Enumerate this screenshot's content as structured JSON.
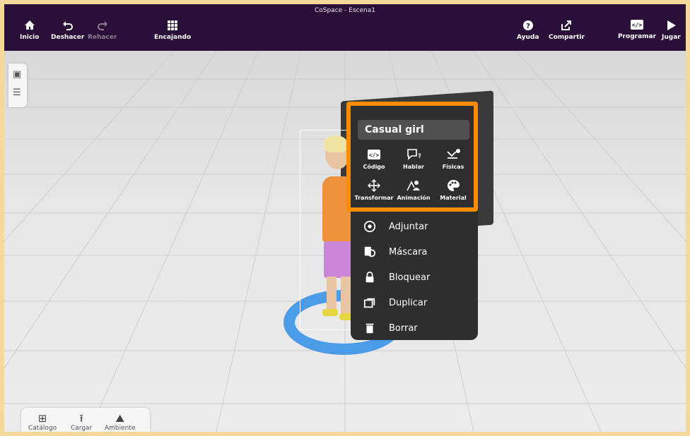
{
  "window": {
    "title": "CoSpace - Escena1"
  },
  "toolbar": {
    "home": "Inicio",
    "undo": "Deshacer",
    "redo": "Rehacer",
    "snap": "Encajando",
    "help": "Ayuda",
    "share": "Compartir",
    "code": "Programar",
    "play": "Jugar"
  },
  "object_card": {
    "name": "Casual girl",
    "tools": [
      "Código",
      "Hablar",
      "Físicas",
      "Transformar",
      "Animación",
      "Material"
    ]
  },
  "context_menu": {
    "items": [
      "Adjuntar",
      "Máscara",
      "Bloquear",
      "Duplicar",
      "Borrar"
    ]
  },
  "bottom_panel": {
    "catalog": "Catálogo",
    "upload": "Cargar",
    "environment": "Ambiente"
  },
  "colors": {
    "topbar": "#2a0f38",
    "highlight": "#ff8c00",
    "ring": "#4a9be8",
    "menu": "#2e2e2e"
  }
}
